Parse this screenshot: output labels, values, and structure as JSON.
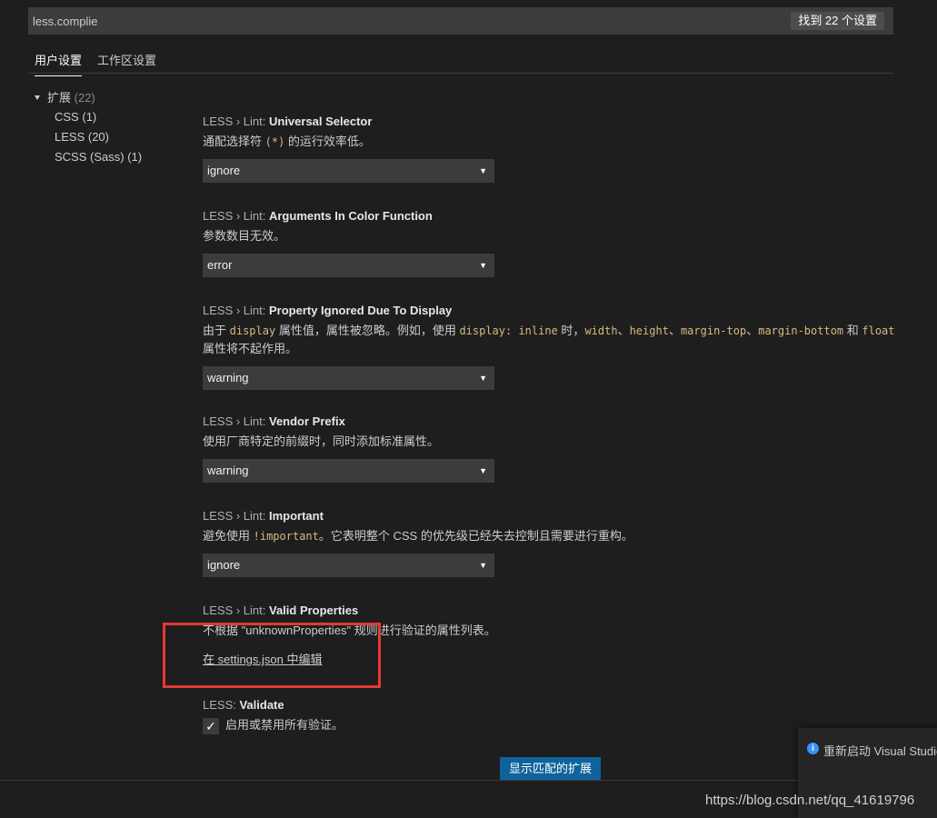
{
  "search": {
    "value": "less.complie",
    "result_count": "找到 22 个设置"
  },
  "tabs": [
    {
      "label": "用户设置",
      "active": true
    },
    {
      "label": "工作区设置",
      "active": false
    }
  ],
  "tree": {
    "root": {
      "label": "扩展",
      "count": "(22)"
    },
    "items": [
      {
        "label": "CSS",
        "count": "(1)"
      },
      {
        "label": "LESS",
        "count": "(20)"
      },
      {
        "label": "SCSS (Sass)",
        "count": "(1)"
      }
    ]
  },
  "settings": {
    "universal_selector": {
      "category": "LESS › Lint: ",
      "name": "Universal Selector",
      "desc_before": "通配选择符 ",
      "desc_code": "(*)",
      "desc_after": " 的运行效率低。",
      "value": "ignore"
    },
    "args_color_function": {
      "category": "LESS › Lint: ",
      "name": "Arguments In Color Function",
      "desc": "参数数目无效。",
      "value": "error"
    },
    "property_ignored": {
      "category": "LESS › Lint: ",
      "name": "Property Ignored Due To Display",
      "desc_p1": "由于 ",
      "code1": "display",
      "desc_p2": " 属性值，属性被忽略。例如，使用 ",
      "code2": "display: inline",
      "desc_p3": " 时，",
      "code3": "width",
      "sep1": "、",
      "code4": "height",
      "sep2": "、",
      "code5": "margin-top",
      "sep3": "、",
      "code6": "margin-bottom",
      "desc_p4": " 和 ",
      "code7": "float",
      "desc_line2": "属性将不起作用。",
      "value": "warning"
    },
    "vendor_prefix": {
      "category": "LESS › Lint: ",
      "name": "Vendor Prefix",
      "desc": "使用厂商特定的前缀时，同时添加标准属性。",
      "value": "warning"
    },
    "important": {
      "category": "LESS › Lint: ",
      "name": "Important",
      "desc_before": "避免使用 ",
      "desc_code": "!important",
      "desc_after": "。它表明整个 CSS 的优先级已经失去控制且需要进行重构。",
      "value": "ignore"
    },
    "valid_properties": {
      "category": "LESS › Lint: ",
      "name": "Valid Properties",
      "desc": "不根据 \"unknownProperties\" 规则进行验证的属性列表。",
      "edit_link": "在 settings.json 中编辑"
    },
    "validate": {
      "category": "LESS: ",
      "name": "Validate",
      "checkbox_label": "启用或禁用所有验证。",
      "checked": true
    }
  },
  "footer": {
    "show_extensions_button": "显示匹配的扩展"
  },
  "notification": {
    "icon": "info-icon",
    "text": "重新启动 Visual Studio"
  },
  "watermark": "https://blog.csdn.net/qq_41619796",
  "colors": {
    "background": "#1e1e1e",
    "input": "#3c3c3c",
    "button": "#0e639c",
    "highlight": "#e53935",
    "code": "#d7ba7d"
  }
}
